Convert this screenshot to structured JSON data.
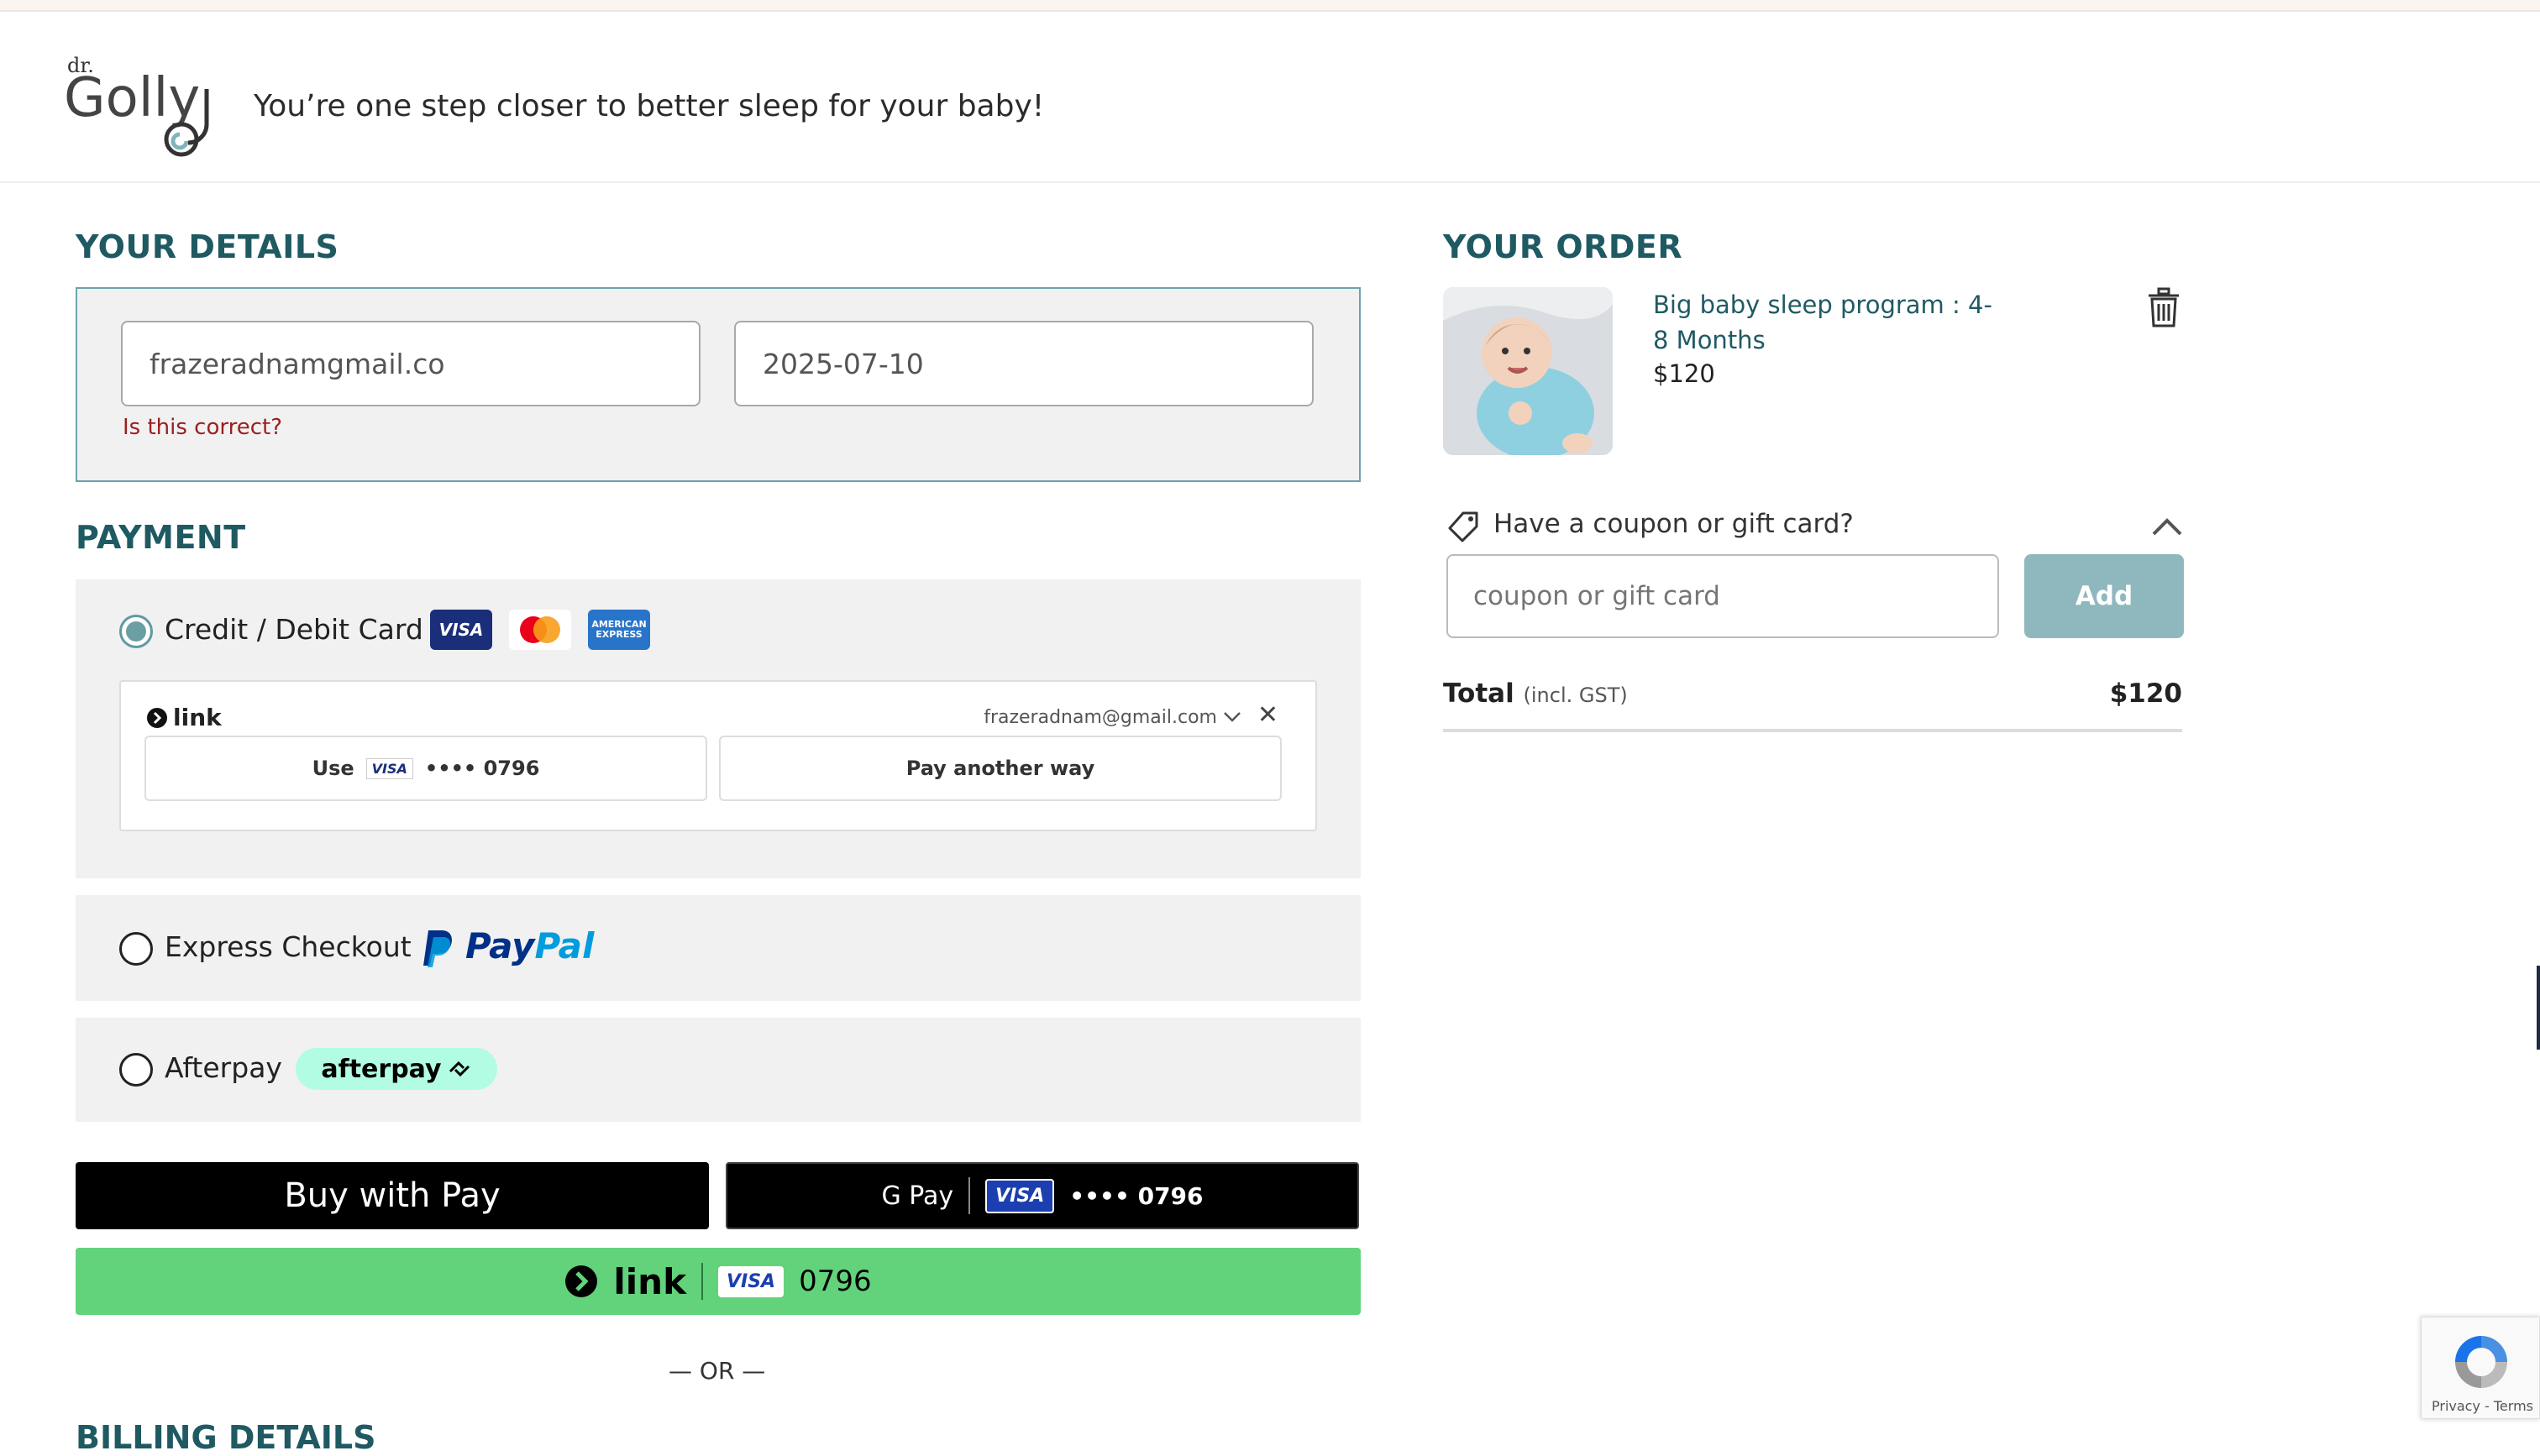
{
  "header": {
    "logo_small": "dr.",
    "logo_main": "Golly",
    "tagline": "You’re one step closer to better sleep for your baby!"
  },
  "details": {
    "title": "YOUR DETAILS",
    "email_value": "frazeradnamgmail.co",
    "date_value": "2025-07-10",
    "email_error": "Is this correct?"
  },
  "payment": {
    "title": "PAYMENT",
    "card_label": "Credit / Debit Card",
    "card_brands": [
      "VISA",
      "MC",
      "AMERICAN EXPRESS"
    ],
    "link": {
      "logo": "link",
      "email": "frazeradnam@gmail.com",
      "use_label": "Use",
      "card_dots": "•••• 0796",
      "card_brand": "VISA",
      "another": "Pay another way"
    },
    "paypal_label": "Express Checkout",
    "paypal_logo": "PayPal",
    "afterpay_label": "Afterpay",
    "afterpay_logo": "afterpay"
  },
  "wallets": {
    "apple_pay": "Buy with  Pay",
    "gpay_logo": "G Pay",
    "gpay_brand": "VISA",
    "gpay_card": "•••• 0796",
    "link_logo": "link",
    "link_brand": "VISA",
    "link_card": "0796"
  },
  "or_text": "— OR —",
  "billing_title": "BILLING DETAILS",
  "order": {
    "title": "YOUR ORDER",
    "product_name": "Big baby sleep program : 4-8 Months",
    "product_price": "$120",
    "coupon_label": "Have a coupon or gift card?",
    "coupon_placeholder": "coupon or gift card",
    "add_label": "Add",
    "total_label": "Total",
    "total_incl": "(incl. GST)",
    "total_value": "$120"
  },
  "recaptcha": {
    "terms": "Privacy - Terms"
  },
  "colors": {
    "accent": "#1f5a63",
    "radio_selected": "#6b9fa6",
    "link_green": "#62d37b",
    "add_button": "#8fb8be",
    "error": "#9b2020"
  }
}
